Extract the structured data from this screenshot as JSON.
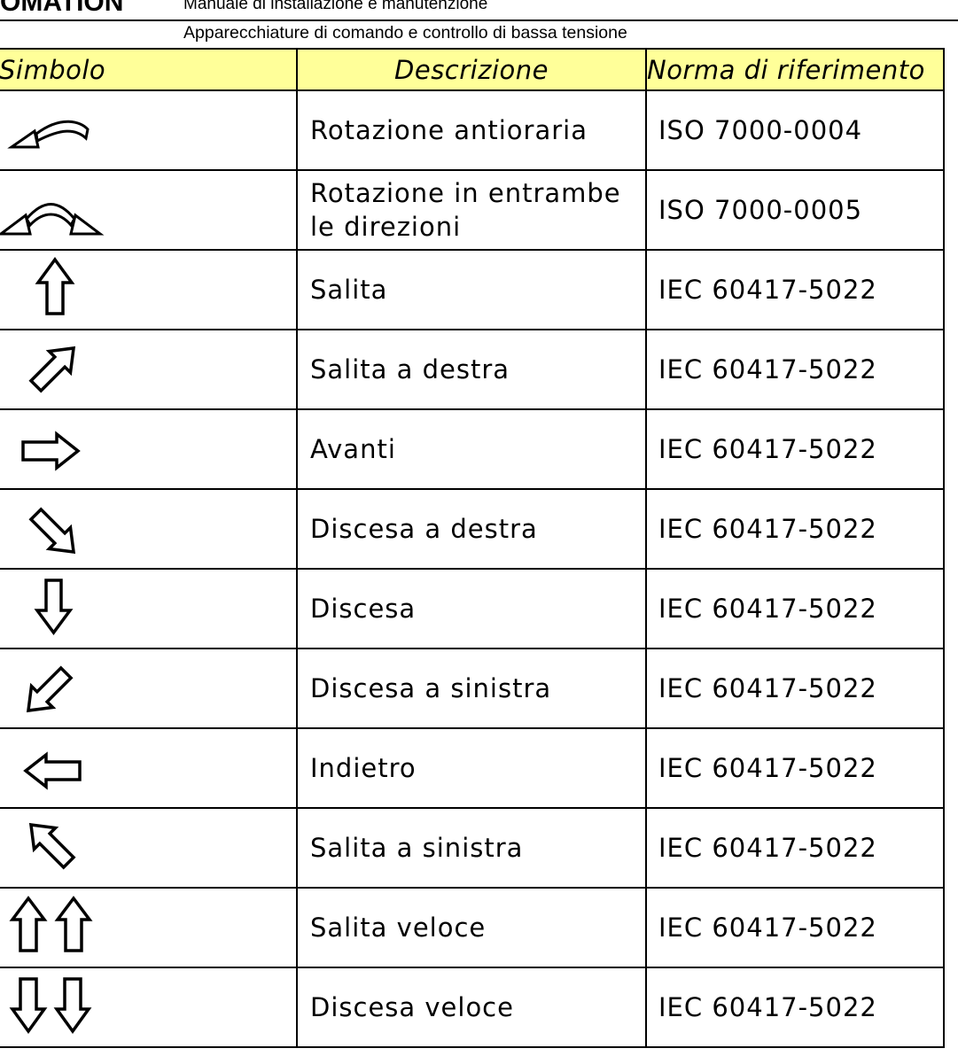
{
  "header": {
    "brand": "OMATION",
    "manual_title": "Manuale di installazione e manutenzione",
    "section_title": "Apparecchiature di comando e controllo di bassa tensione"
  },
  "table": {
    "columns": [
      "Simbolo",
      "Descrizione",
      "Norma di riferimento"
    ],
    "rows": [
      {
        "icon": "rotate-counterclockwise-icon",
        "description": "Rotazione antioraria",
        "norm": "ISO 7000-0004"
      },
      {
        "icon": "rotate-both-directions-icon",
        "description": "Rotazione in entrambe le direzioni",
        "norm": "ISO 7000-0005"
      },
      {
        "icon": "arrow-up-icon",
        "description": "Salita",
        "norm": "IEC 60417-5022"
      },
      {
        "icon": "arrow-up-right-icon",
        "description": "Salita a destra",
        "norm": "IEC 60417-5022"
      },
      {
        "icon": "arrow-right-icon",
        "description": "Avanti",
        "norm": "IEC 60417-5022"
      },
      {
        "icon": "arrow-down-right-icon",
        "description": "Discesa a destra",
        "norm": "IEC 60417-5022"
      },
      {
        "icon": "arrow-down-icon",
        "description": "Discesa",
        "norm": "IEC 60417-5022"
      },
      {
        "icon": "arrow-down-left-icon",
        "description": "Discesa a sinistra",
        "norm": "IEC 60417-5022"
      },
      {
        "icon": "arrow-left-icon",
        "description": "Indietro",
        "norm": "IEC 60417-5022"
      },
      {
        "icon": "arrow-up-left-icon",
        "description": "Salita a sinistra",
        "norm": "IEC 60417-5022"
      },
      {
        "icon": "double-arrow-up-icon",
        "description": "Salita veloce",
        "norm": "IEC 60417-5022"
      },
      {
        "icon": "double-arrow-down-icon",
        "description": "Discesa veloce",
        "norm": "IEC 60417-5022"
      }
    ]
  },
  "colors": {
    "header_fill": "#ffff99",
    "border": "#000000"
  }
}
